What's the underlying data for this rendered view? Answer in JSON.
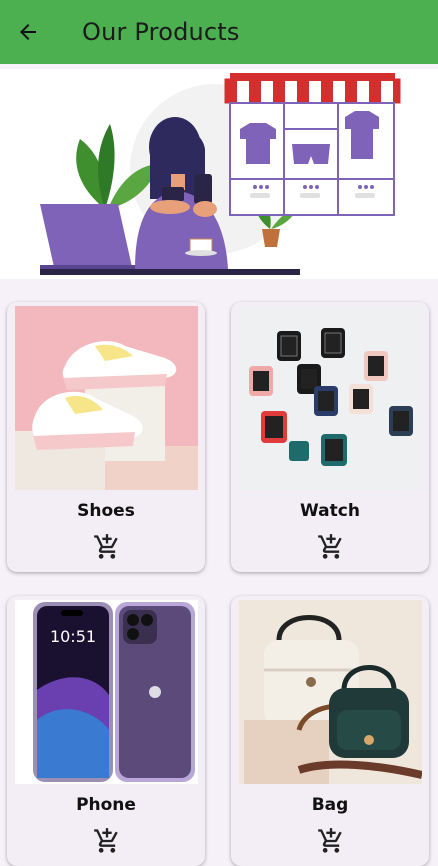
{
  "appbar": {
    "title": "Our Products",
    "color": "#4caf50"
  },
  "products": [
    {
      "name": "Shoes",
      "cart_icon": "add-shopping-cart-icon"
    },
    {
      "name": "Watch",
      "cart_icon": "add-shopping-cart-icon"
    },
    {
      "name": "Phone",
      "cart_icon": "add-shopping-cart-icon"
    },
    {
      "name": "Bag",
      "cart_icon": "add-shopping-cart-icon"
    }
  ]
}
